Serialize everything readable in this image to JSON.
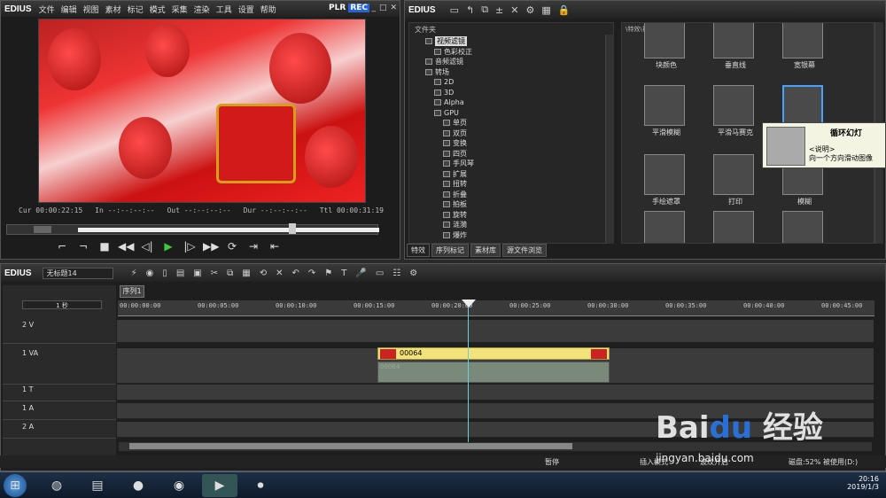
{
  "player": {
    "brand": "EDIUS",
    "menu": [
      "文件",
      "编辑",
      "视图",
      "素材",
      "标记",
      "模式",
      "采集",
      "渲染",
      "工具",
      "设置",
      "帮助"
    ],
    "plr": "PLR",
    "rec": "REC",
    "cur_label": "Cur",
    "cur": "00:00:22:15",
    "in_label": "In",
    "in": "--:--:--:--",
    "out_label": "Out",
    "out": "--:--:--:--",
    "dur_label": "Dur",
    "dur": "--:--:--:--",
    "ttl_label": "Ttl",
    "ttl": "00:00:31:19",
    "scrub_progress": 0.75,
    "transport_icons": [
      "stop-icon",
      "rewind-icon",
      "step-back-icon",
      "play-icon",
      "step-forward-icon",
      "fast-forward-icon",
      "loop-icon"
    ]
  },
  "effects": {
    "brand": "EDIUS",
    "tree_header": "文件夹",
    "tree": [
      {
        "label": "视频滤镜",
        "indent": 1,
        "selected": true
      },
      {
        "label": "色彩校正",
        "indent": 2
      },
      {
        "label": "音频滤镜",
        "indent": 1
      },
      {
        "label": "转场",
        "indent": 1
      },
      {
        "label": "2D",
        "indent": 2
      },
      {
        "label": "3D",
        "indent": 2
      },
      {
        "label": "Alpha",
        "indent": 2
      },
      {
        "label": "GPU",
        "indent": 2
      },
      {
        "label": "单页",
        "indent": 3
      },
      {
        "label": "双页",
        "indent": 3
      },
      {
        "label": "变换",
        "indent": 3
      },
      {
        "label": "四页",
        "indent": 3
      },
      {
        "label": "手风琴",
        "indent": 3
      },
      {
        "label": "扩展",
        "indent": 3
      },
      {
        "label": "扭转",
        "indent": 3
      },
      {
        "label": "折叠",
        "indent": 3
      },
      {
        "label": "拍板",
        "indent": 3
      },
      {
        "label": "旋转",
        "indent": 3
      },
      {
        "label": "涟漪",
        "indent": 3
      },
      {
        "label": "爆炸",
        "indent": 3
      }
    ],
    "path": "\\特效\\视频滤镜\\",
    "items": [
      {
        "label": "块颜色"
      },
      {
        "label": "垂直线"
      },
      {
        "label": "宽银幕"
      },
      {
        "label": "平滑模糊"
      },
      {
        "label": "平滑马赛克"
      },
      {
        "label": "循环幻灯",
        "selected": true
      },
      {
        "label": "手绘遮罩"
      },
      {
        "label": "打印"
      },
      {
        "label": "模糊"
      }
    ],
    "tooltip": {
      "title": "循环幻灯",
      "sub": "<说明>",
      "desc": "向一个方向滑动图像"
    },
    "tabs": [
      "特效",
      "序列标记",
      "素材库",
      "源文件浏览"
    ],
    "active_tab": 0
  },
  "timeline": {
    "brand": "EDIUS",
    "project": "无标题14",
    "sequence_tab": "序列1",
    "zoom": "1 秒",
    "ruler": [
      "00:00:00:00",
      "00:00:05:00",
      "00:00:10:00",
      "00:00:15:00",
      "00:00:20:00",
      "00:00:25:00",
      "00:00:30:00",
      "00:00:35:00",
      "00:00:40:00",
      "00:00:45:00"
    ],
    "tracks": [
      {
        "label": "2 V"
      },
      {
        "label": "1 VA"
      },
      {
        "label": "1 T"
      },
      {
        "label": "1 A"
      },
      {
        "label": "2 A"
      }
    ],
    "clip_name": "00064",
    "clip_audio_name": "00064",
    "status": [
      "暂停",
      "插入模式",
      "波纹开启",
      "磁盘:52% 被使用(D:)"
    ]
  },
  "taskbar": {
    "time": "20:16",
    "date": "2019/1/3"
  },
  "watermark": "jingyan.baidu.com"
}
